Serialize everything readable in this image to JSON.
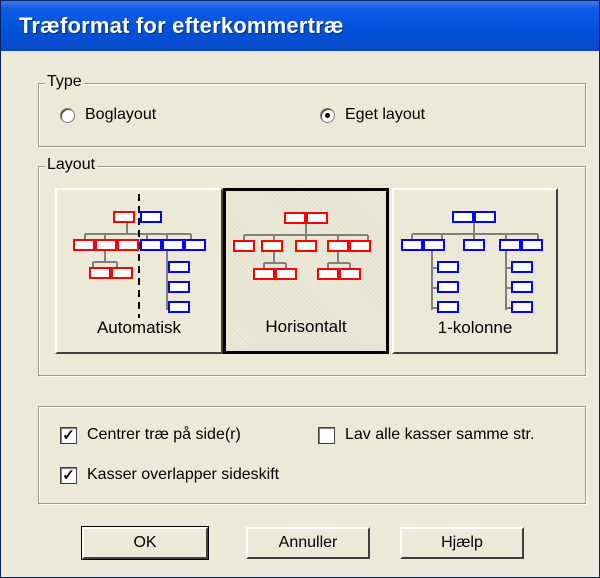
{
  "window": {
    "title": "Træformat for efterkommertræ"
  },
  "type_group": {
    "label": "Type",
    "options": [
      {
        "label": "Boglayout",
        "selected": false
      },
      {
        "label": "Eget layout",
        "selected": true
      }
    ]
  },
  "layout_group": {
    "label": "Layout",
    "buttons": [
      {
        "label": "Automatisk",
        "selected": false,
        "icon": "tree-split-icon"
      },
      {
        "label": "Horisontalt",
        "selected": true,
        "icon": "tree-horizontal-icon"
      },
      {
        "label": "1-kolonne",
        "selected": false,
        "icon": "tree-column-icon"
      }
    ]
  },
  "options": {
    "center": {
      "label": "Centrer træ på side(r)",
      "checked": true
    },
    "same_size": {
      "label": "Lav alle kasser samme str.",
      "checked": false
    },
    "overlap": {
      "label": "Kasser overlapper sideskift",
      "checked": true
    }
  },
  "buttons": {
    "ok": "OK",
    "cancel": "Annuller",
    "help": "Hjælp"
  },
  "colors": {
    "red": "#ff0000",
    "blue": "#0000ff",
    "line": "#808080",
    "titlebar": "#0052d8"
  }
}
